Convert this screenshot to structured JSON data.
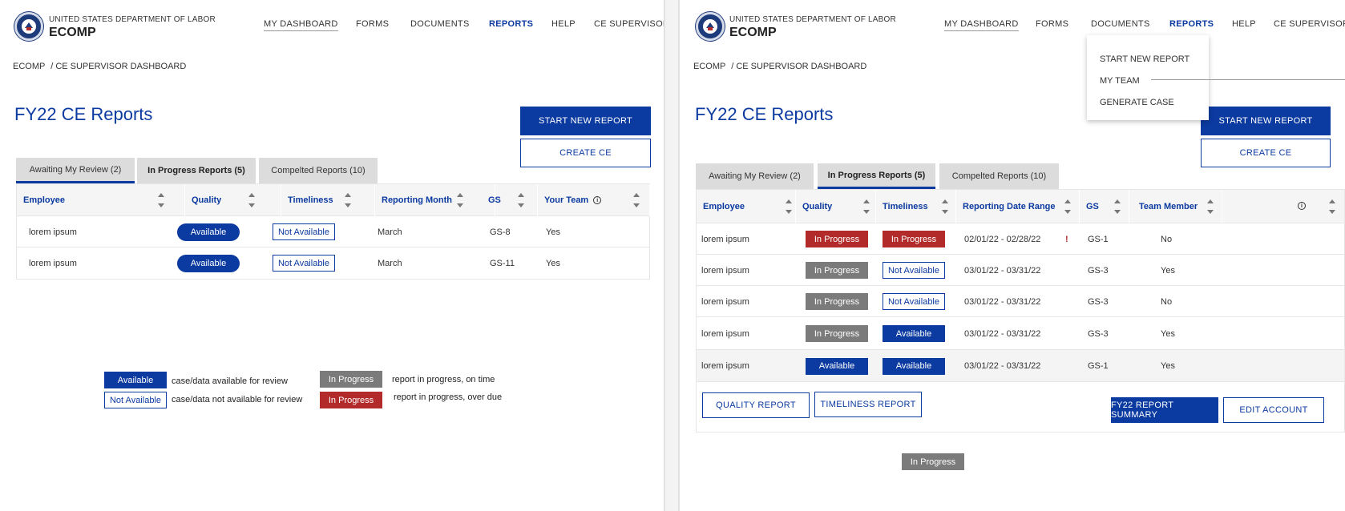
{
  "header": {
    "agency": "UNITED STATES DEPARTMENT OF LABOR",
    "app_name": "ECOMP",
    "nav": [
      "MY DASHBOARD",
      "FORMS",
      "DOCUMENTS",
      "REPORTS",
      "HELP",
      "CE SUPERVISOR"
    ]
  },
  "breadcrumb": {
    "root": "ECOMP",
    "current": "/ CE SUPERVISOR DASHBOARD"
  },
  "page_title": "FY22 CE Reports",
  "buttons": {
    "start_new_report": "START NEW REPORT",
    "create_ce": "CREATE CE"
  },
  "tabs": [
    "Awaiting My Review (2)",
    "In Progress Reports (5)",
    "Compelted Reports (10)"
  ],
  "left_table": {
    "headers": [
      "Employee",
      "Quality",
      "Timeliness",
      "Reporting Month",
      "GS",
      "Your Team"
    ],
    "rows": [
      {
        "employee": "lorem ipsum",
        "quality": "Available",
        "timeliness": "Not Available",
        "month": "March",
        "gs": "GS-8",
        "team": "Yes"
      },
      {
        "employee": "lorem ipsum",
        "quality": "Available",
        "timeliness": "Not Available",
        "month": "March",
        "gs": "GS-11",
        "team": "Yes"
      }
    ]
  },
  "legend": {
    "available": "Available",
    "available_desc": "case/data available for review",
    "not_available": "Not Available",
    "not_available_desc": "case/data not available for review",
    "in_progress": "In Progress",
    "in_progress_on_time": "report in progress, on time",
    "in_progress_over_due": "report in progress, over due"
  },
  "reports_menu": [
    "START NEW REPORT",
    "MY TEAM",
    "GENERATE CASE"
  ],
  "right_table": {
    "headers": [
      "Employee",
      "Quality",
      "Timeliness",
      "Reporting Date Range",
      "GS",
      "Team Member"
    ],
    "rows": [
      {
        "employee": "lorem ipsum",
        "quality": "In Progress",
        "timeliness": "In Progress",
        "range": "02/01/22 - 02/28/22",
        "flag": "!",
        "gs": "GS-1",
        "member": "No"
      },
      {
        "employee": "lorem ipsum",
        "quality": "In Progress",
        "timeliness": "Not Available",
        "range": "03/01/22 - 03/31/22",
        "flag": "",
        "gs": "GS-3",
        "member": "Yes"
      },
      {
        "employee": "lorem ipsum",
        "quality": "In Progress",
        "timeliness": "Not Available",
        "range": "03/01/22 - 03/31/22",
        "flag": "",
        "gs": "GS-3",
        "member": "No"
      },
      {
        "employee": "lorem ipsum",
        "quality": "In Progress",
        "timeliness": "Available",
        "range": "03/01/22 - 03/31/22",
        "flag": "",
        "gs": "GS-3",
        "member": "Yes"
      },
      {
        "employee": "lorem ipsum",
        "quality": "Available",
        "timeliness": "Available",
        "range": "03/01/22 - 03/31/22",
        "flag": "",
        "gs": "GS-1",
        "member": "Yes"
      }
    ]
  },
  "right_footer": {
    "quality_report": "QUALITY REPORT",
    "timeliness_report": "TIMELINESS REPORT",
    "fy22_summary": "FY22 REPORT SUMMARY",
    "edit_account": "EDIT ACCOUNT"
  },
  "floating_badge": "In Progress",
  "colors": {
    "primary": "#0b3aa0",
    "overdue": "#b22a2a",
    "in_progress_gray": "#7b7b7b",
    "tab_gray": "#dcdcdc"
  }
}
